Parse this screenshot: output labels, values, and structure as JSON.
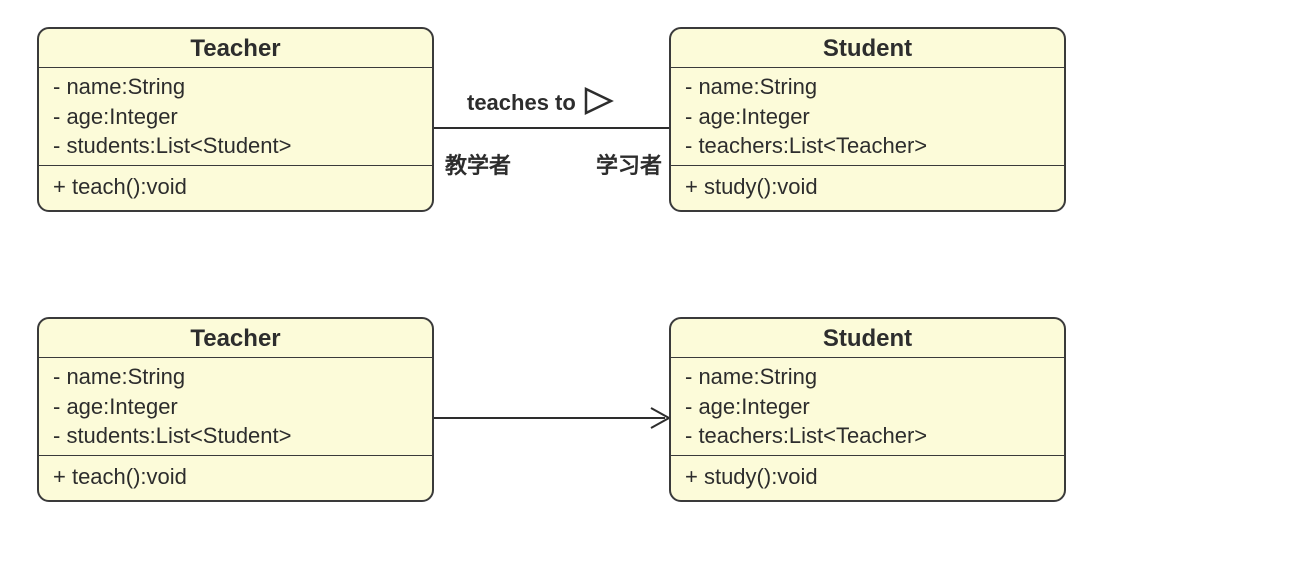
{
  "diagram": {
    "top": {
      "left_class": {
        "name": "Teacher",
        "attributes": [
          "- name:String",
          "- age:Integer",
          "- students:List<Student>"
        ],
        "operations": [
          "+ teach():void"
        ]
      },
      "right_class": {
        "name": "Student",
        "attributes": [
          "- name:String",
          "- age:Integer",
          "- teachers:List<Teacher>"
        ],
        "operations": [
          "+ study():void"
        ]
      },
      "association": {
        "label": "teaches to",
        "left_role": "教学者",
        "right_role": "学习者"
      }
    },
    "bottom": {
      "left_class": {
        "name": "Teacher",
        "attributes": [
          "- name:String",
          "- age:Integer",
          "- students:List<Student>"
        ],
        "operations": [
          "+ teach():void"
        ]
      },
      "right_class": {
        "name": "Student",
        "attributes": [
          "- name:String",
          "- age:Integer",
          "- teachers:List<Teacher>"
        ],
        "operations": [
          "+ study():void"
        ]
      }
    }
  }
}
